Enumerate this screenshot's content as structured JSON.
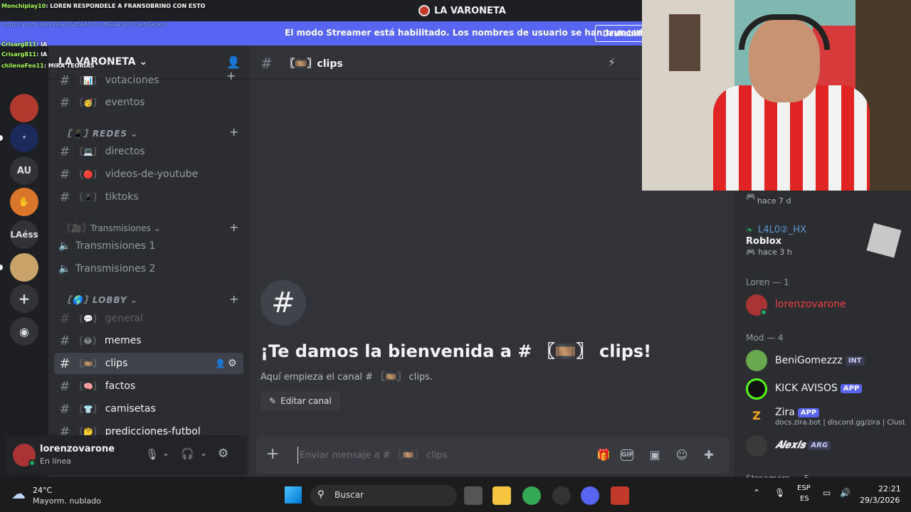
{
  "window": {
    "title": "LA VARONETA"
  },
  "banner": {
    "message": "El modo Streamer está habilitado. Los nombres de usuario se han truncado.",
    "button": "Deshabilit"
  },
  "rail": {
    "servers": [
      "AU",
      "LAéss"
    ]
  },
  "server": {
    "name": "LA VARONETA"
  },
  "channels": {
    "top": [
      {
        "name": "votaciones",
        "emoji": "〖📊〗"
      },
      {
        "name": "eventos",
        "emoji": "〖🥳〗"
      }
    ],
    "cat_redes": "〖📱〗REDES",
    "redes": [
      {
        "name": "directos",
        "emoji": "〖💻〗"
      },
      {
        "name": "videos-de-youtube",
        "emoji": "〖🔴〗"
      },
      {
        "name": "tiktoks",
        "emoji": "〖📱〗"
      }
    ],
    "cat_trans": "〖🎥〗Transmisiones",
    "voice": [
      "Transmisiones 1",
      "Transmisiones 2"
    ],
    "cat_lobby": "〖🌎〗LOBBY",
    "lobby": [
      {
        "name": "general",
        "emoji": "〖💬〗"
      },
      {
        "name": "memes",
        "emoji": "〖😂〗"
      },
      {
        "name": "clips",
        "emoji": "〖🎞️〗"
      },
      {
        "name": "factos",
        "emoji": "〖🧠〗"
      },
      {
        "name": "camisetas",
        "emoji": "〖👕〗"
      },
      {
        "name": "predicciones-futbol",
        "emoji": "〖🤔〗"
      }
    ]
  },
  "user": {
    "name": "lorenzovarone",
    "status": "En línea"
  },
  "chat": {
    "channel_name": "〖🎞️〗clips",
    "welcome": "¡Te damos la bienvenida a # 〖🎞️〗 clips!",
    "subtitle": "Aquí empieza el canal # 〖🎞️〗 clips.",
    "edit_button": "Editar canal",
    "placeholder": "Enviar mensaje a # 〖🎞️〗 clips"
  },
  "members": {
    "activity1_time": "hace 7 d",
    "activity2_user": "L4L0②_HX",
    "activity2_game": "Roblox",
    "activity2_time": "hace 3 h",
    "cat_loren": "Loren — 1",
    "loren_user": "lorenzovarone",
    "cat_mod": "Mod — 4",
    "mods": [
      {
        "name": "BeniGomezzz",
        "tag": "INT"
      },
      {
        "name": "KICK AVISOS",
        "tag": "APP"
      },
      {
        "name": "Zira",
        "tag": "APP",
        "sub": "docs.zira.bot | discord.gg/zira | Clust"
      },
      {
        "name": "𝑨𝒍𝒆𝒙𝒊𝒔",
        "tag": "ARG"
      }
    ],
    "cat_streamers": "Streamers — 5"
  },
  "overlay": [
    {
      "user": "Monchiplay10",
      "text": ": LOREN RESPONDELE A FRANSOBRINO CON ESTO"
    },
    {
      "link": "https://youtu.be/xXRwOS0EeA8?si=MG8A3aTTQw60apkm"
    },
    {
      "user": "Crisarg811",
      "text": ": IA"
    },
    {
      "user": "Crisarg811",
      "text": ": IA"
    },
    {
      "user": "chilenoFeo11",
      "text": ": MIRA TEORIAS"
    }
  ],
  "taskbar": {
    "temp": "24°C",
    "weather": "Mayorm. nublado",
    "search": "Buscar",
    "lang1": "ESP",
    "lang2": "ES",
    "time": "22:21",
    "date": "29/3/2026"
  },
  "colors": {
    "accent": "#5865f2",
    "online": "#23a55a",
    "owner": "#f23f43"
  }
}
